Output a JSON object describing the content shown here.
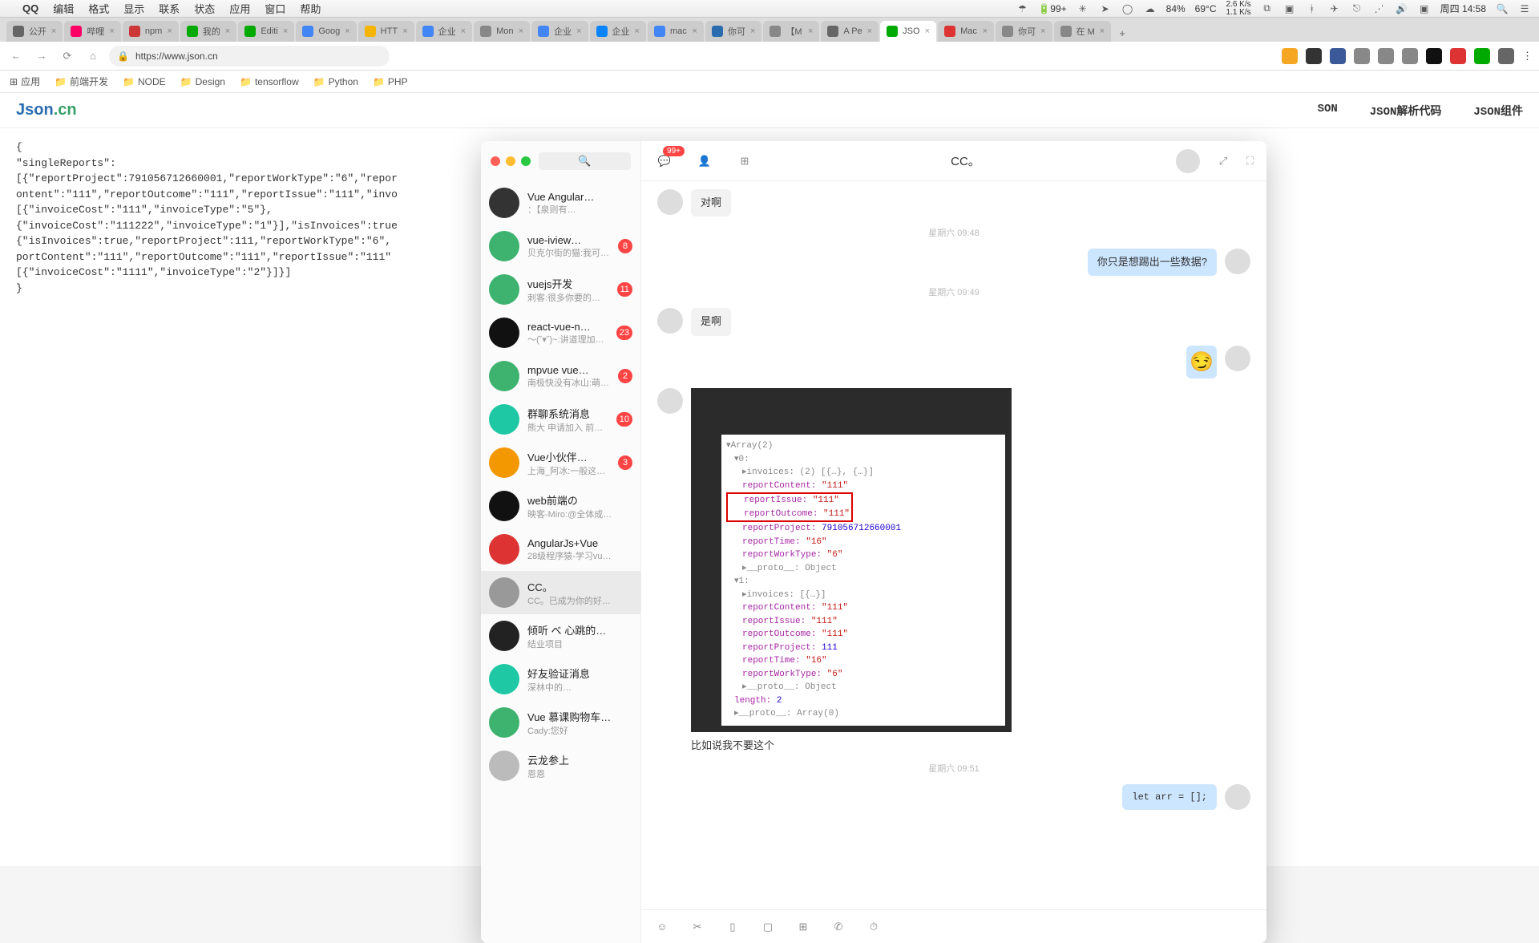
{
  "menubar": {
    "app": "QQ",
    "items": [
      "编辑",
      "格式",
      "显示",
      "联系",
      "状态",
      "应用",
      "窗口",
      "帮助"
    ],
    "battery": "99+",
    "cpu": "84%",
    "temp": "69°C",
    "net_up": "2.6 K/s",
    "net_down": "1.1 K/s",
    "clock": "周四 14:58"
  },
  "tabs": [
    {
      "label": "公开",
      "fav": "#666"
    },
    {
      "label": "哔哩",
      "fav": "#f06"
    },
    {
      "label": "npm",
      "fav": "#cb3837"
    },
    {
      "label": "我的",
      "fav": "#0a0"
    },
    {
      "label": "Editi",
      "fav": "#0a0"
    },
    {
      "label": "Goog",
      "fav": "#4285f4"
    },
    {
      "label": "HTT",
      "fav": "#f4b400"
    },
    {
      "label": "企业",
      "fav": "#4285f4"
    },
    {
      "label": "Mon",
      "fav": "#888"
    },
    {
      "label": "企业",
      "fav": "#4285f4"
    },
    {
      "label": "企业",
      "fav": "#0a84ff"
    },
    {
      "label": "mac",
      "fav": "#4285f4"
    },
    {
      "label": "你可",
      "fav": "#2b6cb0"
    },
    {
      "label": "【M",
      "fav": "#888"
    },
    {
      "label": "A Pe",
      "fav": "#666"
    },
    {
      "label": "JSO",
      "fav": "#0a0",
      "active": true
    },
    {
      "label": "Mac",
      "fav": "#d33"
    },
    {
      "label": "你可",
      "fav": "#888"
    },
    {
      "label": "在 M",
      "fav": "#888"
    }
  ],
  "addr": {
    "url": "https://www.json.cn"
  },
  "bookmarks": [
    "应用",
    "前端开发",
    "NODE",
    "Design",
    "tensorflow",
    "Python",
    "PHP"
  ],
  "page": {
    "logo_a": "Json",
    "logo_b": ".cn",
    "nav": [
      "SON",
      "JSON解析代码",
      "JSON组件"
    ],
    "json_text": "{\n\"singleReports\":\n[{\"reportProject\":791056712660001,\"reportWorkType\":\"6\",\"repor\nontent\":\"111\",\"reportOutcome\":\"111\",\"reportIssue\":\"111\",\"invo\n[{\"invoiceCost\":\"111\",\"invoiceType\":\"5\"},\n{\"invoiceCost\":\"111222\",\"invoiceType\":\"1\"}],\"isInvoices\":true\n{\"isInvoices\":true,\"reportProject\":111,\"reportWorkType\":\"6\",\nportContent\":\"111\",\"reportOutcome\":\"111\",\"reportIssue\":\"111\"\n[{\"invoiceCost\":\"1111\",\"invoiceType\":\"2\"}]}]\n}"
  },
  "qq": {
    "title": "CC。",
    "unread": "99+",
    "contacts": [
      {
        "name": "Vue Angular…",
        "sub": "：【泉则有…",
        "badge": "",
        "color": "#333"
      },
      {
        "name": "vue-iview…",
        "sub": "贝克尔街的猫:我可…",
        "badge": "8",
        "color": "#3eb370"
      },
      {
        "name": "vuejs开发",
        "sub": "刺客:很多你要的福…",
        "badge": "11",
        "color": "#3eb370"
      },
      {
        "name": "react-vue-n…",
        "sub": "～(˘▾˘)~:讲道理加…",
        "badge": "23",
        "color": "#111"
      },
      {
        "name": "mpvue vue…",
        "sub": "南极快没有冰山:萌…",
        "badge": "2",
        "color": "#3eb370"
      },
      {
        "name": "群聊系统消息",
        "sub": "熊大 申请加入 前…",
        "badge": "10",
        "color": "#1ec8a5"
      },
      {
        "name": "Vue小伙伴…",
        "sub": "上海_阿冰:一般这样…",
        "badge": "3",
        "color": "#f39800"
      },
      {
        "name": "web前端の",
        "sub": "映客-Miro:@全体成…",
        "badge": "",
        "color": "#111"
      },
      {
        "name": "AngularJs+Vue",
        "sub": "28级程序猿-学习vu…",
        "badge": "",
        "color": "#d33"
      },
      {
        "name": "CC。",
        "sub": "CC。已成为你的好…",
        "badge": "",
        "color": "#999",
        "sel": true
      },
      {
        "name": "倾听 べ 心跳的…",
        "sub": "结业项目",
        "badge": "",
        "color": "#222"
      },
      {
        "name": "好友验证消息",
        "sub": "深林中的…",
        "badge": "",
        "color": "#1ec8a5"
      },
      {
        "name": "Vue 慕课购物车…",
        "sub": "Cady:您好",
        "badge": "",
        "color": "#3eb370"
      },
      {
        "name": "云龙参上",
        "sub": "恩恩",
        "badge": "",
        "color": "#bbb"
      }
    ],
    "chat": {
      "m1": "对啊",
      "t1": "星期六 09:48",
      "m2": "你只是想踢出一些数据?",
      "t2": "星期六 09:49",
      "m3": "是啊",
      "caption": "比如说我不要这个",
      "t3": "星期六 09:51",
      "m4": "let arr = [];"
    },
    "dev": {
      "header": "▾Array(2)",
      "l0": "▾0:",
      "l1": "▸invoices: (2) [{…}, {…}]",
      "l2": "reportContent: \"111\"",
      "l3": "reportIssue: \"111\"",
      "l4": "reportOutcome: \"111\"",
      "l5": "reportProject: 791056712660001",
      "l6": "reportTime: \"16\"",
      "l7": "reportWorkType: \"6\"",
      "l8": "▸__proto__: Object",
      "l9": "▾1:",
      "l10": "▸invoices: [{…}]",
      "l11": "reportContent: \"111\"",
      "l12": "reportIssue: \"111\"",
      "l13": "reportOutcome: \"111\"",
      "l14": "reportProject: 111",
      "l15": "reportTime: \"16\"",
      "l16": "reportWorkType: \"6\"",
      "l17": "▸__proto__: Object",
      "l18": "length: 2",
      "l19": "▸__proto__: Array(0)"
    }
  }
}
